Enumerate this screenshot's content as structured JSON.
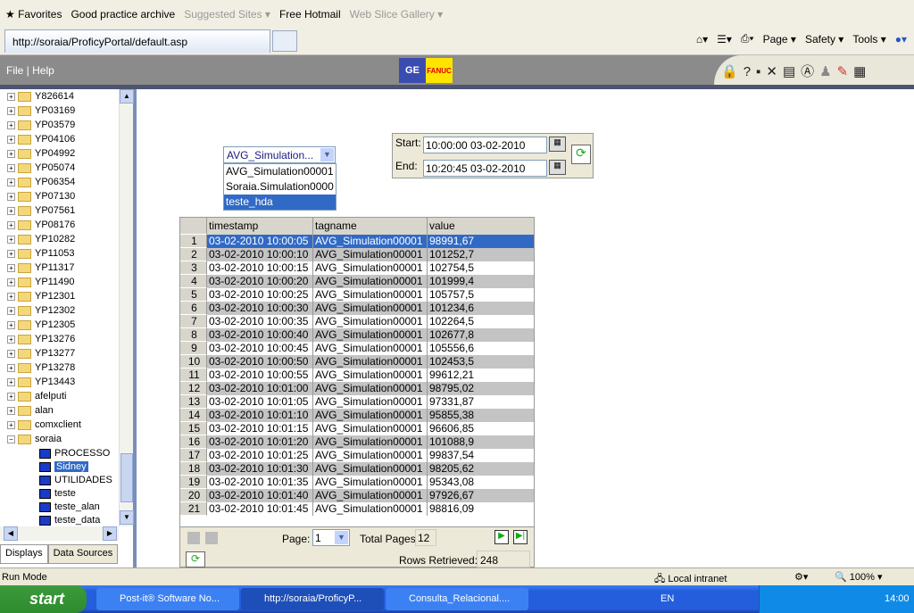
{
  "browser": {
    "favorites": "Favorites",
    "links": [
      {
        "label": "Good practice archive",
        "muted": false
      },
      {
        "label": "Suggested Sites ▾",
        "muted": true
      },
      {
        "label": "Free Hotmail",
        "muted": false
      },
      {
        "label": "Web Slice Gallery ▾",
        "muted": true
      }
    ],
    "tab_title": "http://soraia/ProficyPortal/default.asp",
    "commands": [
      "Page ▾",
      "Safety ▾",
      "Tools ▾"
    ]
  },
  "app": {
    "menu": [
      "File",
      "Help"
    ],
    "logo": [
      "GE",
      "FANUC"
    ]
  },
  "tree": {
    "folders": [
      "Y826614",
      "YP03169",
      "YP03579",
      "YP04106",
      "YP04992",
      "YP05074",
      "YP06354",
      "YP07130",
      "YP07561",
      "YP08176",
      "YP10282",
      "YP11053",
      "YP11317",
      "YP11490",
      "YP12301",
      "YP12302",
      "YP12305",
      "YP13276",
      "YP13277",
      "YP13278",
      "YP13443",
      "afelputi",
      "alan",
      "comxclient",
      "soraia"
    ],
    "children": [
      "PROCESSO",
      "Sidney",
      "UTILIDADES",
      "teste",
      "teste_alan",
      "teste_data"
    ],
    "selected": "Sidney"
  },
  "left_tabs": [
    "Displays",
    "Data Sources"
  ],
  "tag_select": {
    "value": "AVG_Simulation...",
    "options": [
      "AVG_Simulation00001",
      "Soraia.Simulation0000",
      "teste_hda"
    ],
    "highlighted": "teste_hda"
  },
  "time": {
    "start_label": "Start:",
    "start": "10:00:00 03-02-2010",
    "end_label": "End:",
    "end": "10:20:45 03-02-2010"
  },
  "grid": {
    "columns": [
      "timestamp",
      "tagname",
      "value"
    ],
    "rows": [
      [
        "1",
        "03-02-2010 10:00:05",
        "AVG_Simulation00001",
        "98991,67"
      ],
      [
        "2",
        "03-02-2010 10:00:10",
        "AVG_Simulation00001",
        "101252,7"
      ],
      [
        "3",
        "03-02-2010 10:00:15",
        "AVG_Simulation00001",
        "102754,5"
      ],
      [
        "4",
        "03-02-2010 10:00:20",
        "AVG_Simulation00001",
        "101999,4"
      ],
      [
        "5",
        "03-02-2010 10:00:25",
        "AVG_Simulation00001",
        "105757,5"
      ],
      [
        "6",
        "03-02-2010 10:00:30",
        "AVG_Simulation00001",
        "101234,6"
      ],
      [
        "7",
        "03-02-2010 10:00:35",
        "AVG_Simulation00001",
        "102264,5"
      ],
      [
        "8",
        "03-02-2010 10:00:40",
        "AVG_Simulation00001",
        "102677,8"
      ],
      [
        "9",
        "03-02-2010 10:00:45",
        "AVG_Simulation00001",
        "105556,6"
      ],
      [
        "10",
        "03-02-2010 10:00:50",
        "AVG_Simulation00001",
        "102453,5"
      ],
      [
        "11",
        "03-02-2010 10:00:55",
        "AVG_Simulation00001",
        "99612,21"
      ],
      [
        "12",
        "03-02-2010 10:01:00",
        "AVG_Simulation00001",
        "98795,02"
      ],
      [
        "13",
        "03-02-2010 10:01:05",
        "AVG_Simulation00001",
        "97331,87"
      ],
      [
        "14",
        "03-02-2010 10:01:10",
        "AVG_Simulation00001",
        "95855,38"
      ],
      [
        "15",
        "03-02-2010 10:01:15",
        "AVG_Simulation00001",
        "96606,85"
      ],
      [
        "16",
        "03-02-2010 10:01:20",
        "AVG_Simulation00001",
        "101088,9"
      ],
      [
        "17",
        "03-02-2010 10:01:25",
        "AVG_Simulation00001",
        "99837,54"
      ],
      [
        "18",
        "03-02-2010 10:01:30",
        "AVG_Simulation00001",
        "98205,62"
      ],
      [
        "19",
        "03-02-2010 10:01:35",
        "AVG_Simulation00001",
        "95343,08"
      ],
      [
        "20",
        "03-02-2010 10:01:40",
        "AVG_Simulation00001",
        "97926,67"
      ],
      [
        "21",
        "03-02-2010 10:01:45",
        "AVG_Simulation00001",
        "98816,09"
      ]
    ],
    "selected_row": 1
  },
  "pager": {
    "page_label": "Page:",
    "page": "1",
    "total_label": "Total Pages",
    "total": "12",
    "rows_label": "Rows Retrieved:",
    "rows": "248"
  },
  "status": {
    "mode": "Run Mode",
    "zone": "Local intranet",
    "zoom": "100%"
  },
  "taskbar": {
    "start": "start",
    "items": [
      "Post-it® Software No...",
      "http://soraia/ProficyP...",
      "Consulta_Relacional...."
    ],
    "lang": "EN",
    "clock": "14:00"
  },
  "colors": {
    "selection": "#316ac5",
    "header": "#8b8b8b",
    "taskbar": "#245edc"
  }
}
